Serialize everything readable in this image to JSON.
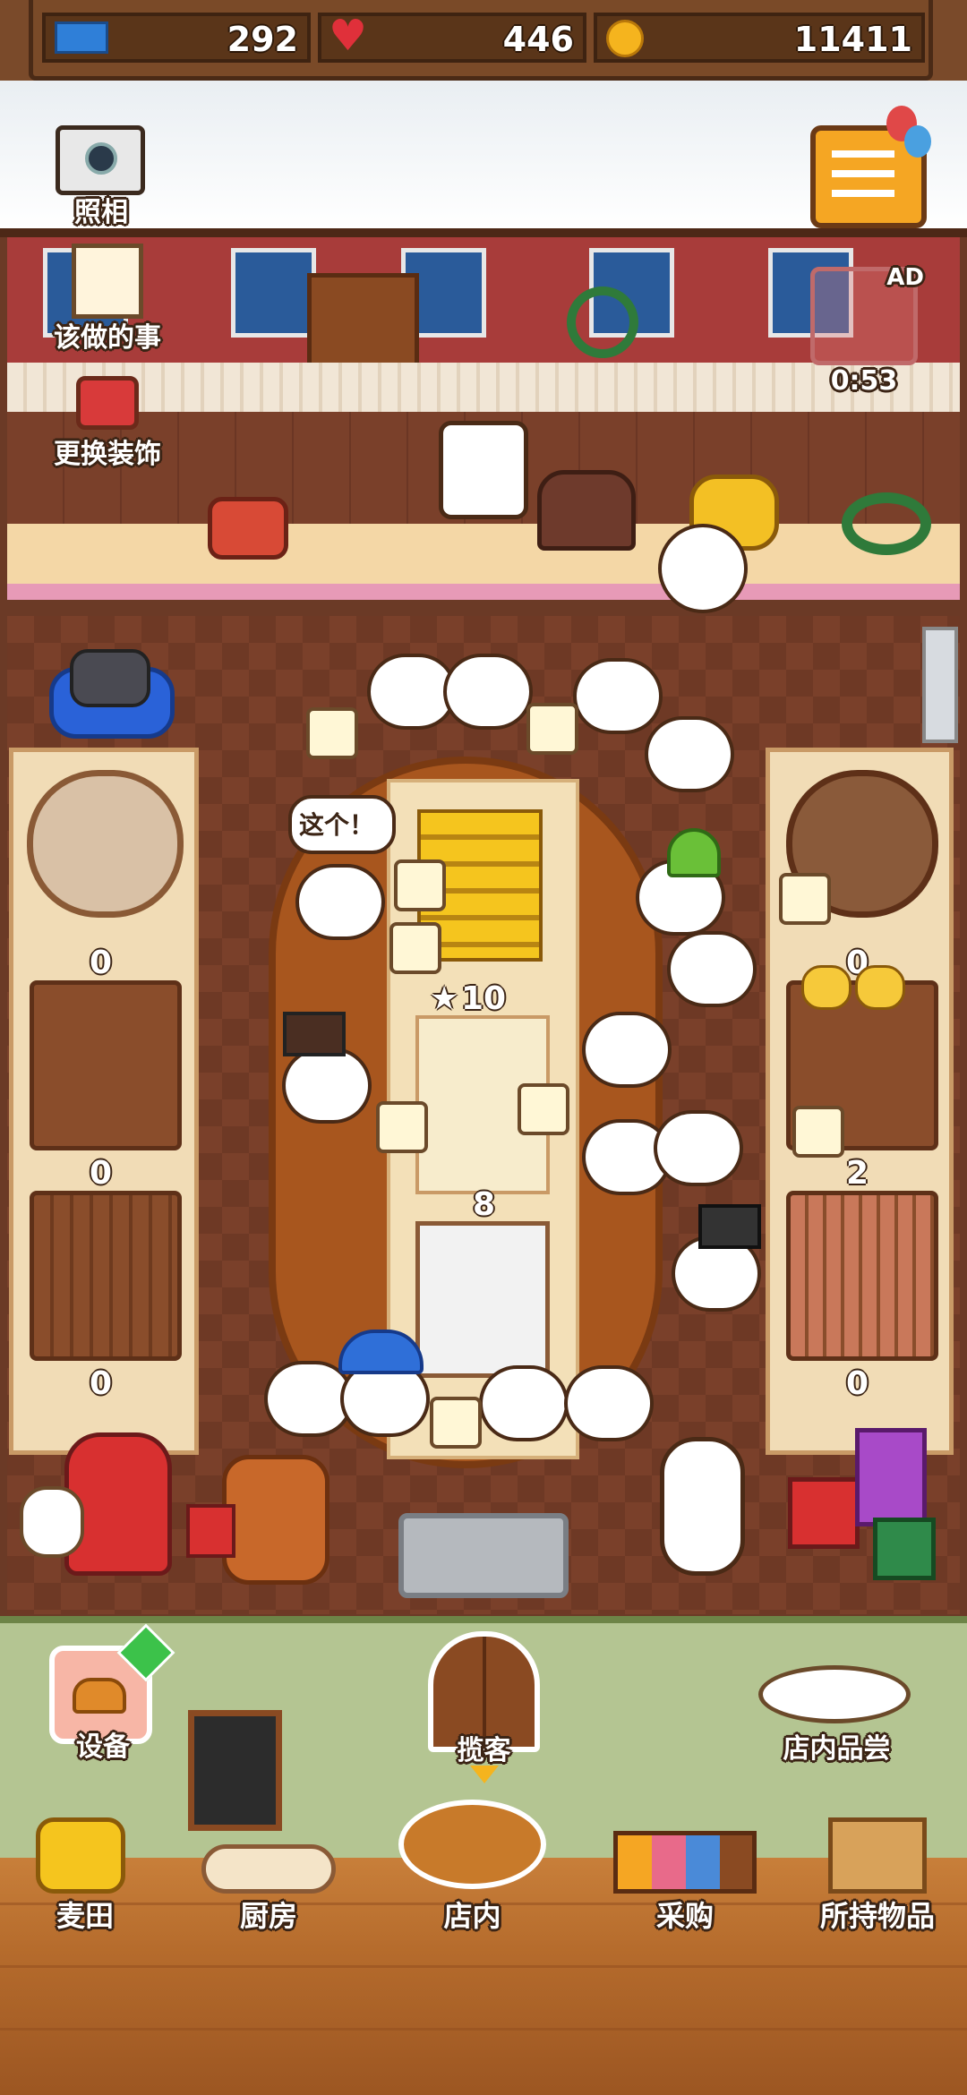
{
  "resources": {
    "tickets": "292",
    "hearts": "446",
    "coins": "11411"
  },
  "top_buttons": {
    "camera_label": "照相"
  },
  "left_menu": {
    "todo_label": "该做的事",
    "decorate_label": "更换装饰"
  },
  "ad": {
    "badge": "AD",
    "timer": "0:53"
  },
  "speech_bubble": "这个！",
  "table_counts": {
    "left_top": "0",
    "left_middle": "0",
    "left_bottom": "0",
    "right_top": "0",
    "right_middle": "2",
    "right_bottom": "0",
    "center_sandwich": "10",
    "center_drinks": "8"
  },
  "actions": {
    "equipment": "设备",
    "invite": "揽客",
    "tasting": "店内品尝"
  },
  "nav": {
    "items": [
      "麦田",
      "厨房",
      "店内",
      "采购",
      "所持物品"
    ]
  },
  "colors": {
    "wall": "#a83c3a",
    "floor": "#7a402a",
    "grass": "#b4c592",
    "wood": "#b56b2c"
  }
}
